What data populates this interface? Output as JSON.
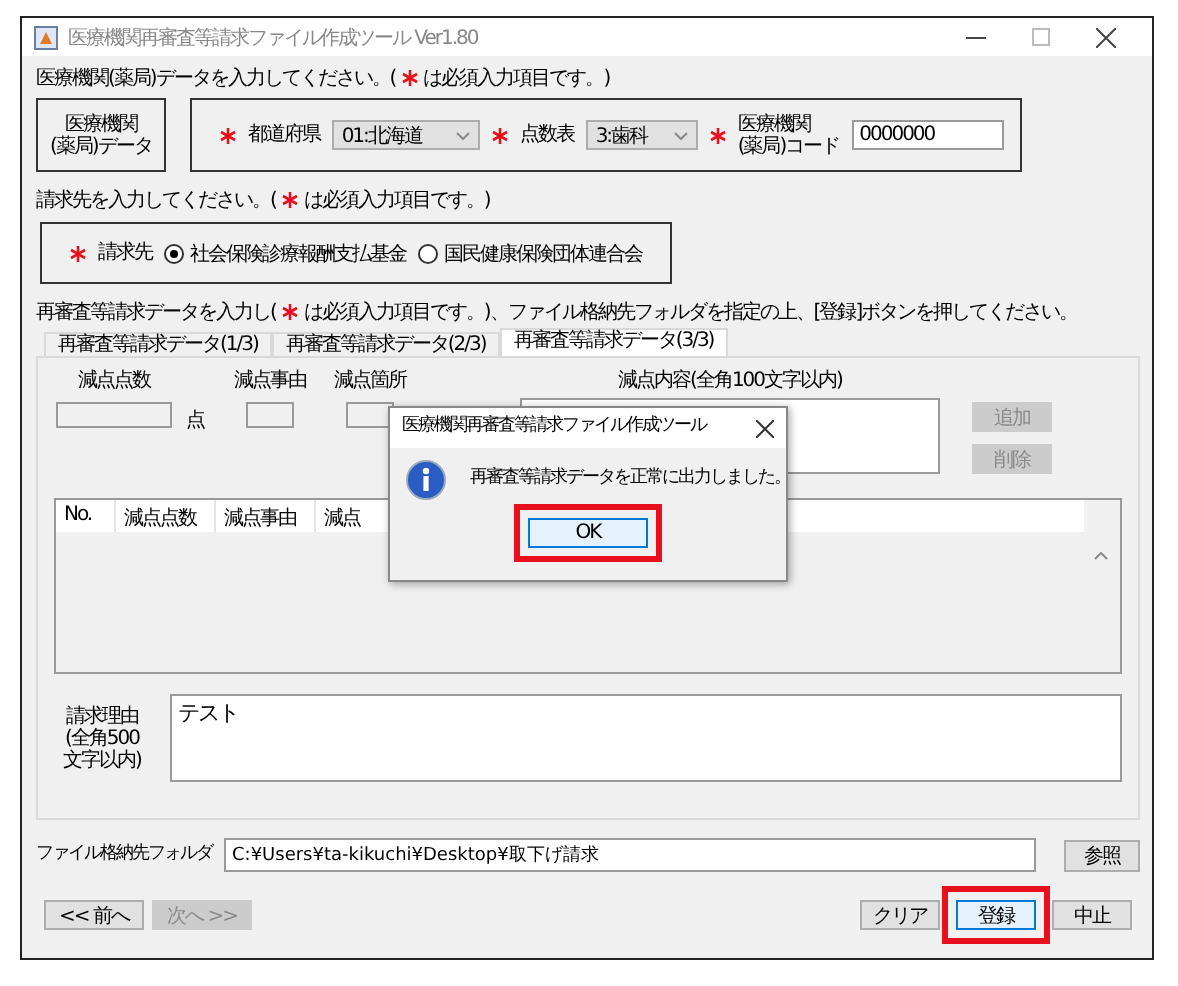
{
  "window": {
    "title": "医療機関再審査等請求ファイル作成ツール Ver1.80"
  },
  "institution_prompt": {
    "before": "医療機関(薬局)データを入力してください。(",
    "required": true,
    "after": "は必須入力項目です。)"
  },
  "institution": {
    "label": "医療機関\n(薬局)データ",
    "fields": [
      {
        "kind": "select",
        "label": "都道府県",
        "value": "01:北海道",
        "required": true
      },
      {
        "kind": "select",
        "label": "点数表",
        "value": "3:歯科",
        "required": true
      },
      {
        "kind": "input",
        "label": "医療機関\n(薬局)コード",
        "value": "0000000",
        "required": true
      }
    ]
  },
  "billing_prompt": {
    "before": "請求先を入力してください。(",
    "required": true,
    "after": "は必須入力項目です。)"
  },
  "billing": {
    "label": "請求先",
    "required": true,
    "options": [
      {
        "label": "社会保険診療報酬支払基金",
        "selected": true
      },
      {
        "label": "国民健康保険団体連合会",
        "selected": false
      }
    ]
  },
  "request_prompt": {
    "before": "再審査等請求データを入力し(",
    "required": true,
    "after": "は必須入力項目です。)、ファイル格納先フォルダを指定の上、[登録]ボタンを押してください。"
  },
  "tabs": [
    {
      "label": "再審査等請求データ(1/3)",
      "selected": false
    },
    {
      "label": "再審査等請求データ(2/3)",
      "selected": false
    },
    {
      "label": "再審査等請求データ(3/3)",
      "selected": true
    }
  ],
  "deduction": {
    "points_label": "減点点数",
    "unit": "点",
    "reason_label": "減点事由",
    "place_label": "減点箇所",
    "content_label": "減点内容(全角100文字以内)",
    "buttons": [
      {
        "label": "追加",
        "disabled": true
      },
      {
        "label": "削除",
        "disabled": true
      }
    ]
  },
  "table": {
    "columns": [
      "No.",
      "減点点数",
      "減点事由",
      "減点"
    ]
  },
  "reason": {
    "label": "請求理由\n(全角500\n文字以内)",
    "value": "テスト"
  },
  "folder": {
    "label": "ファイル格納先フォルダ",
    "value": "C:¥Users¥ta-kikuchi¥Desktop¥取下げ請求",
    "button": "参照"
  },
  "nav_buttons": [
    {
      "label": "<< 前へ",
      "disabled": false
    },
    {
      "label": "次へ >>",
      "disabled": true
    }
  ],
  "action_buttons": [
    {
      "label": "クリア",
      "highlighted": false
    },
    {
      "label": "登録",
      "highlighted": true
    },
    {
      "label": "中止",
      "highlighted": false
    }
  ],
  "dialog": {
    "title": "医療機関再審査等請求ファイル作成ツール",
    "message": "再審査等請求データを正常に出力しました。",
    "button": {
      "label": "OK",
      "highlighted": true
    }
  }
}
